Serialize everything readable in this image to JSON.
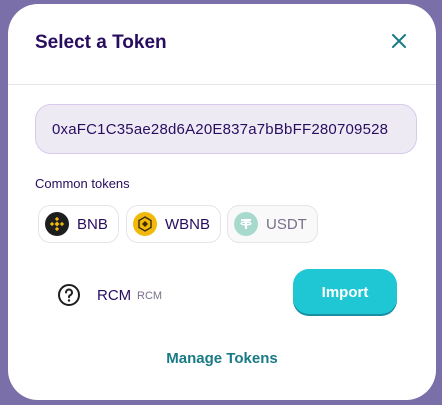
{
  "modal": {
    "title": "Select a Token",
    "close_icon": "close-icon"
  },
  "search": {
    "value": "0xaFC1C35ae28d6A20E837a7bBbFF280709528"
  },
  "common": {
    "label": "Common tokens",
    "tokens": [
      {
        "symbol": "BNB",
        "icon": "bnb-icon",
        "color": "#f0b90b",
        "disabled": false
      },
      {
        "symbol": "WBNB",
        "icon": "wbnb-icon",
        "color": "#f0b90b",
        "disabled": false
      },
      {
        "symbol": "USDT",
        "icon": "usdt-icon",
        "color": "#50af95",
        "disabled": true
      }
    ]
  },
  "result": {
    "icon": "help-icon",
    "symbol": "RCM",
    "name": "RCM",
    "import_label": "Import"
  },
  "footer": {
    "manage_label": "Manage Tokens"
  },
  "colors": {
    "primary_text": "#280d5f",
    "accent": "#1fc7d4",
    "link": "#1a7a85"
  }
}
